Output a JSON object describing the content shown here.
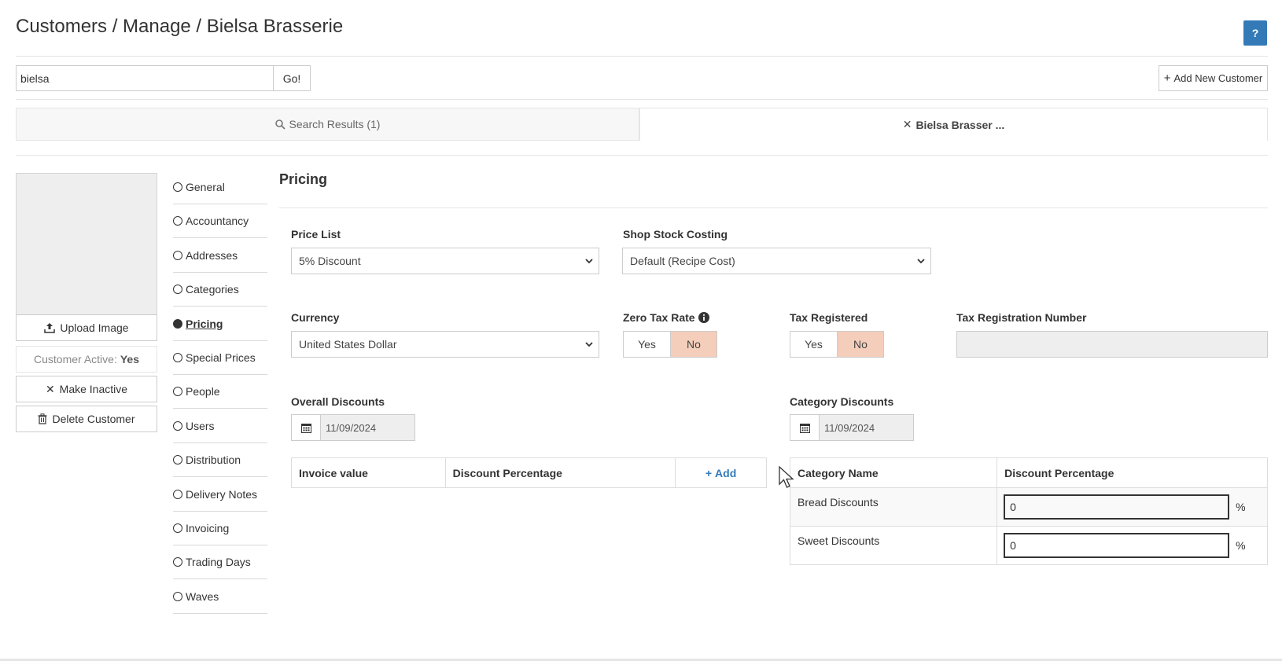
{
  "header": {
    "breadcrumb": "Customers / Manage / Bielsa Brasserie",
    "help_label": "?"
  },
  "search": {
    "value": "bielsa",
    "go_label": "Go!"
  },
  "add_customer_label": "Add New Customer",
  "tabs": {
    "search_results": "Search Results (1)",
    "customer": "Bielsa Brasser ..."
  },
  "sidebar": {
    "upload_label": "Upload Image",
    "active_label": "Customer Active:",
    "active_value": "Yes",
    "make_inactive_label": "Make Inactive",
    "delete_label": "Delete Customer"
  },
  "nav": {
    "items": [
      {
        "label": "General",
        "active": false
      },
      {
        "label": "Accountancy",
        "active": false
      },
      {
        "label": "Addresses",
        "active": false
      },
      {
        "label": "Categories",
        "active": false
      },
      {
        "label": "Pricing",
        "active": true
      },
      {
        "label": "Special Prices",
        "active": false
      },
      {
        "label": "People",
        "active": false
      },
      {
        "label": "Users",
        "active": false
      },
      {
        "label": "Distribution",
        "active": false
      },
      {
        "label": "Delivery Notes",
        "active": false
      },
      {
        "label": "Invoicing",
        "active": false
      },
      {
        "label": "Trading Days",
        "active": false
      },
      {
        "label": "Waves",
        "active": false
      }
    ]
  },
  "pricing": {
    "title": "Pricing",
    "price_list": {
      "label": "Price List",
      "value": "5% Discount"
    },
    "shop_stock_costing": {
      "label": "Shop Stock Costing",
      "value": "Default (Recipe Cost)"
    },
    "currency": {
      "label": "Currency",
      "value": "United States Dollar"
    },
    "zero_tax_rate": {
      "label": "Zero Tax Rate",
      "yes": "Yes",
      "no": "No",
      "selected": "No"
    },
    "tax_registered": {
      "label": "Tax Registered",
      "yes": "Yes",
      "no": "No",
      "selected": "No"
    },
    "tax_registration_number": {
      "label": "Tax Registration Number",
      "value": ""
    },
    "overall_discounts": {
      "label": "Overall Discounts",
      "date": "11/09/2024",
      "columns": [
        "Invoice value",
        "Discount Percentage"
      ],
      "add_label": "Add"
    },
    "category_discounts": {
      "label": "Category Discounts",
      "date": "11/09/2024",
      "columns": [
        "Category Name",
        "Discount Percentage"
      ],
      "rows": [
        {
          "name": "Bread Discounts",
          "value": "0",
          "unit": "%"
        },
        {
          "name": "Sweet Discounts",
          "value": "0",
          "unit": "%"
        }
      ]
    }
  },
  "colors": {
    "accent": "#337ab7",
    "toggle_on": "#f5cdbb",
    "readonly_bg": "#eeeeee"
  }
}
